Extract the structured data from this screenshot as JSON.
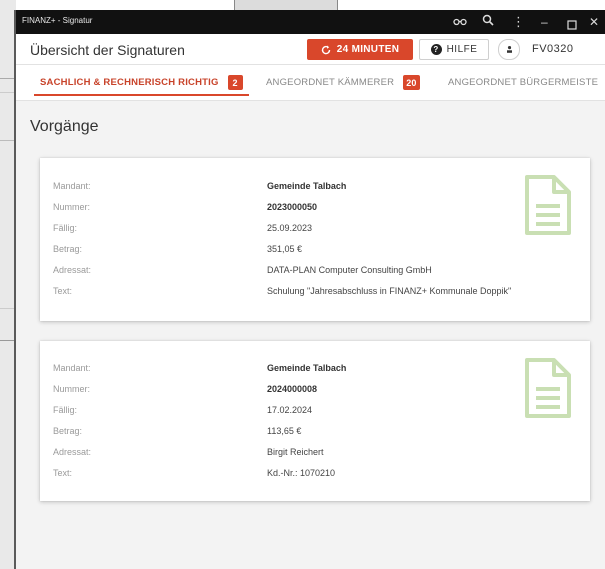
{
  "window": {
    "title": "FINANZ+ - Signatur",
    "controls": [
      "glasses-icon",
      "search-icon",
      "more-icon",
      "minimize-icon",
      "maximize-icon",
      "close-icon"
    ]
  },
  "header": {
    "title": "Übersicht der Signaturen",
    "timer_label": "24 MINUTEN",
    "help_label": "HILFE",
    "user_id": "FV0320"
  },
  "tabs": [
    {
      "label": "SACHLICH & RECHNERISCH RICHTIG",
      "count": "2",
      "active": true
    },
    {
      "label": "ANGEORDNET KÄMMERER",
      "count": "20",
      "active": false
    },
    {
      "label": "ANGEORDNET BÜRGERMEISTE",
      "count": "",
      "active": false
    }
  ],
  "section_title": "Vorgänge",
  "labels": {
    "mandant": "Mandant:",
    "nummer": "Nummer:",
    "faellig": "Fällig:",
    "betrag": "Betrag:",
    "adressat": "Adressat:",
    "text": "Text:"
  },
  "items": [
    {
      "mandant": "Gemeinde Talbach",
      "nummer": "2023000050",
      "faellig": "25.09.2023",
      "betrag": "351,05 €",
      "adressat": "DATA-PLAN Computer Consulting GmbH",
      "text": "Schulung \"Jahresabschluss in FINANZ+ Kommunale Doppik\""
    },
    {
      "mandant": "Gemeinde Talbach",
      "nummer": "2024000008",
      "faellig": "17.02.2024",
      "betrag": "113,65 €",
      "adressat": "Birgit Reichert",
      "text": "Kd.-Nr.: 1070210"
    }
  ],
  "colors": {
    "accent": "#d9472b",
    "doc_icon": "#c9dfb3",
    "titlebar": "#111111"
  }
}
